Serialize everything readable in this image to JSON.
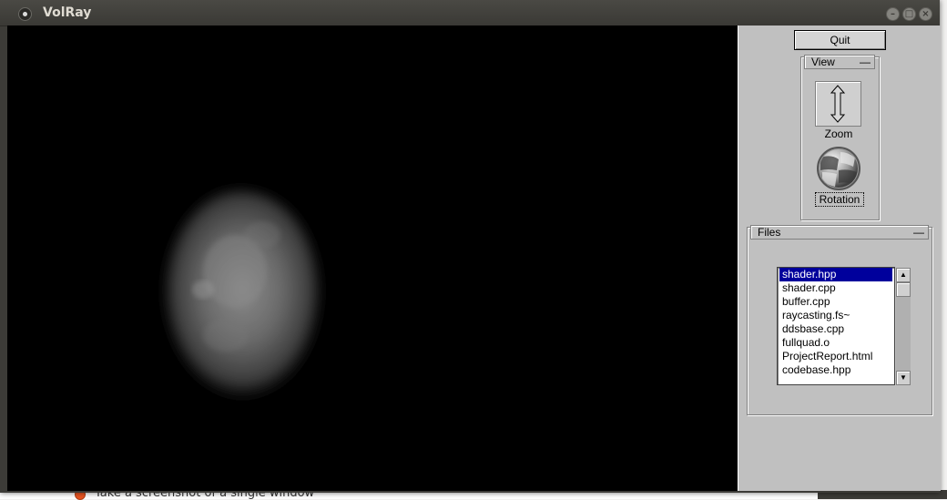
{
  "window": {
    "title": "VolRay"
  },
  "panel": {
    "quit_label": "Quit",
    "view_group": {
      "title": "View",
      "collapse": "—",
      "zoom_label": "Zoom",
      "rotation_label": "Rotation"
    },
    "files_group": {
      "title": "Files",
      "collapse": "—",
      "items": [
        {
          "name": "shader.hpp",
          "selected": true
        },
        {
          "name": "shader.cpp",
          "selected": false
        },
        {
          "name": "buffer.cpp",
          "selected": false
        },
        {
          "name": "raycasting.fs~",
          "selected": false
        },
        {
          "name": "ddsbase.cpp",
          "selected": false
        },
        {
          "name": "fullquad.o",
          "selected": false
        },
        {
          "name": "ProjectReport.html",
          "selected": false
        },
        {
          "name": "codebase.hpp",
          "selected": false
        }
      ]
    }
  },
  "background": {
    "bottom_text": "Take a screenshot of a single window"
  },
  "colors": {
    "selection": "#00009c",
    "panel": "#c0c0c0",
    "viewport": "#000000",
    "titlebar": "#3c3b37"
  }
}
